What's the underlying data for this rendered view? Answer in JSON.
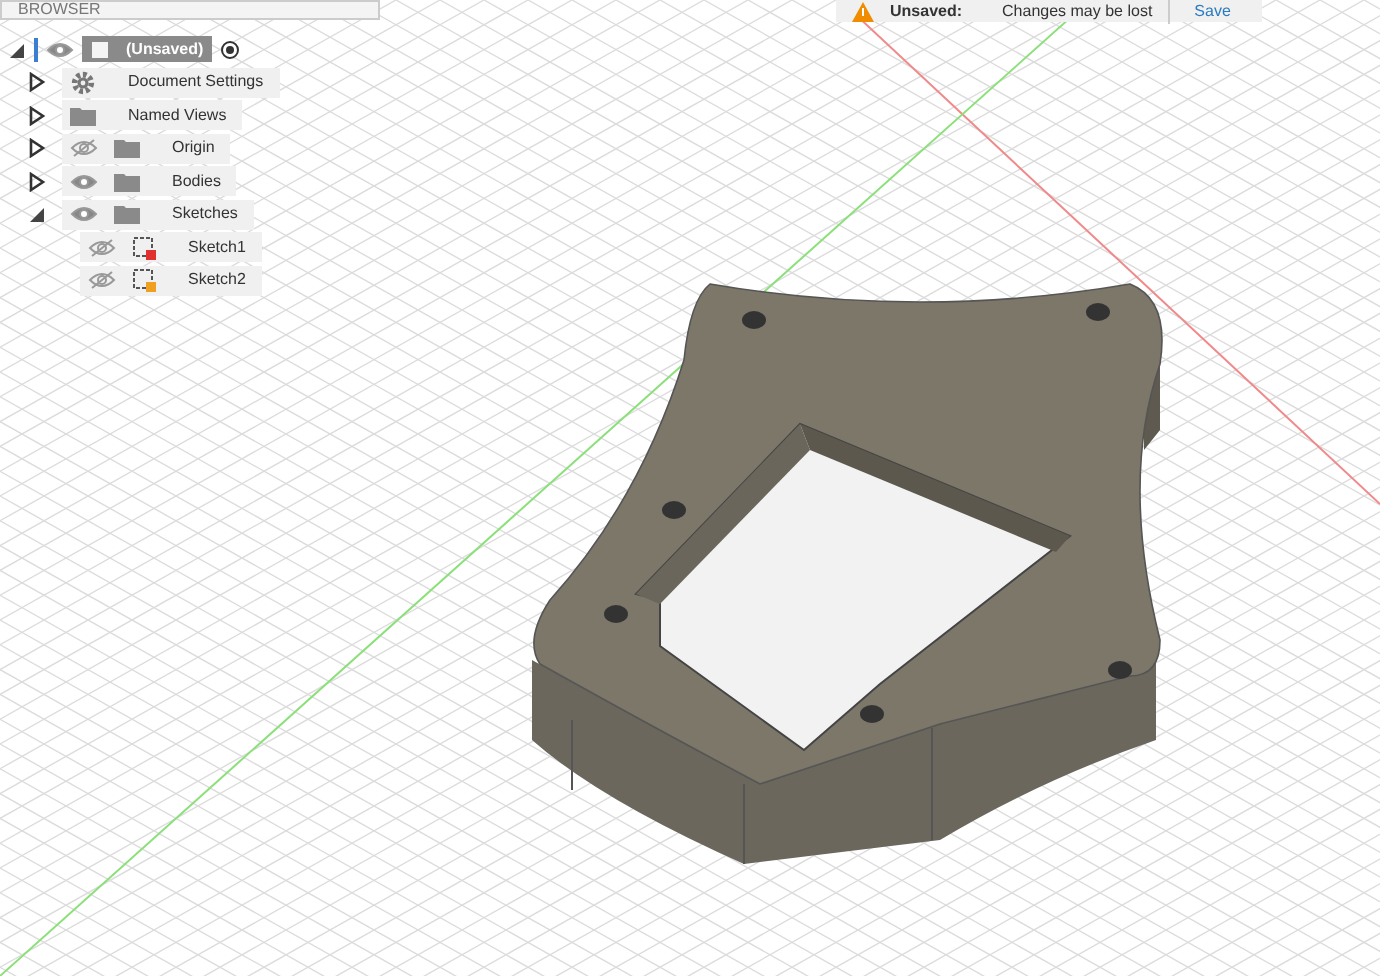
{
  "browser": {
    "title": "BROWSER",
    "root": {
      "label": "(Unsaved)",
      "expanded": true,
      "visible": true
    },
    "items": [
      {
        "kind": "settings",
        "label": "Document Settings",
        "expanded": false
      },
      {
        "kind": "folder",
        "label": "Named Views",
        "expanded": false
      },
      {
        "kind": "folder",
        "label": "Origin",
        "expanded": false,
        "visible": false
      },
      {
        "kind": "folder",
        "label": "Bodies",
        "expanded": false,
        "visible": true
      },
      {
        "kind": "folder",
        "label": "Sketches",
        "expanded": true,
        "visible": true,
        "children": [
          {
            "kind": "sketch",
            "label": "Sketch1",
            "visible": false,
            "color": "#e03030"
          },
          {
            "kind": "sketch",
            "label": "Sketch2",
            "visible": false,
            "color": "#f0a020"
          }
        ]
      }
    ]
  },
  "notification": {
    "label": "Unsaved:",
    "message": "Changes may be lost",
    "button": "Save"
  }
}
